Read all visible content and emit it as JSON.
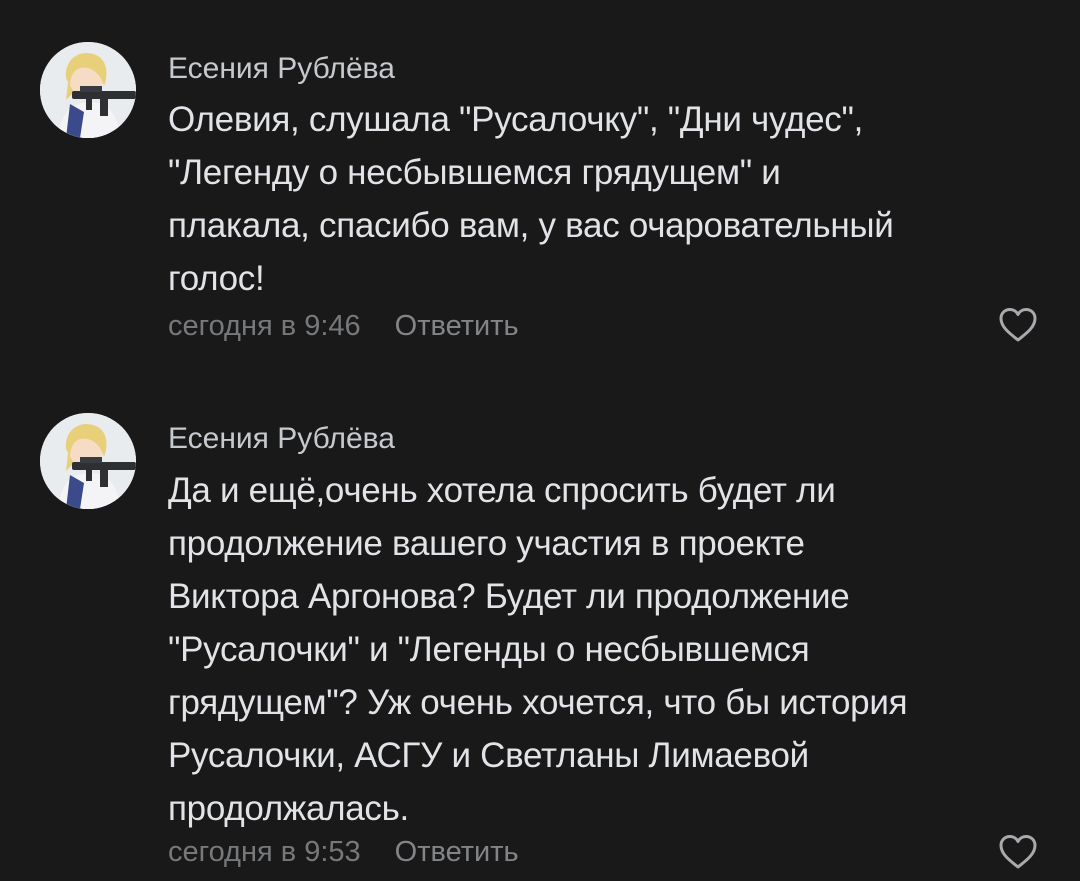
{
  "comments": [
    {
      "author": "Есения Рублёва",
      "lines": [
        "Олевия, слушала \"Русалочку\", \"Дни чудес\",",
        "\"Легенду о несбывшемся грядущем\" и",
        "плакала, спасибо вам, у вас очаровательный",
        "голос!"
      ],
      "time": "сегодня в 9:46",
      "reply_label": "Ответить",
      "like_icon": "heart-outline-icon"
    },
    {
      "author": "Есения Рублёва",
      "lines": [
        "Да и ещё,очень хотела спросить будет ли",
        "продолжение вашего участия в проекте",
        "Виктора Аргонова? Будет ли продолжение",
        "\"Русалочки\" и \"Легенды о несбывшемся",
        "грядущем\"? Уж очень хочется, что бы история",
        "Русалочки, АСГУ и Светланы Лимаевой",
        "продолжалась."
      ],
      "time": "сегодня в 9:53",
      "reply_label": "Ответить",
      "like_icon": "heart-outline-icon"
    }
  ],
  "colors": {
    "background": "#19191a",
    "text": "#e1e3e6",
    "author": "#c6c9ce",
    "meta": "#76787a"
  }
}
